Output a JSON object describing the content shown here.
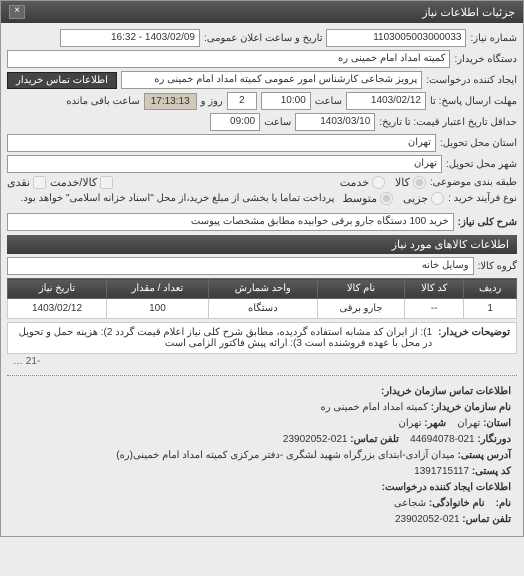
{
  "window": {
    "title": "جزئیات اطلاعات نیاز",
    "close": "×"
  },
  "fields": {
    "number_label": "شماره نیاز:",
    "number_value": "1103005003000033",
    "datetime_label": "تاریخ و ساعت اعلان عمومی:",
    "datetime_value": "1403/02/09 - 16:32",
    "buyer_label": "دستگاه خریدار:",
    "buyer_value": "کمیته امداد امام خمینی ره",
    "creator_label": "ایجاد کننده درخواست:",
    "creator_value": "پرویز شجاعی کارشناس امور عمومی کمیته امداد امام خمینی ره",
    "contact_btn": "اطلاعات تماس خریدار",
    "deadline_send_label": "مهلت ارسال پاسخ: تا",
    "deadline_send_date": "1403/02/12",
    "deadline_send_time_lbl": "ساعت",
    "deadline_send_time": "10:00",
    "days_label": "روز و",
    "days_value": "2",
    "remaining_label": "ساعت باقی مانده",
    "countdown": "17:13:13",
    "valid_label": "حداقل تاریخ اعتبار قیمت: تا تاریخ:",
    "valid_date": "1403/03/10",
    "valid_time_lbl": "ساعت",
    "valid_time": "09:00",
    "province_label": "استان محل تحویل:",
    "province_value": "تهران",
    "city_label": "شهر محل تحویل:",
    "city_value": "تهران",
    "category_label": "طبقه بندی موضوعی:",
    "cat_goods": "کالا",
    "cat_service": "خدمت",
    "payment_label": "کالا/خدمت",
    "pay_cash": "نقدی",
    "process_label": "نوع فرآیند خرید :",
    "proc_small": "جزیی",
    "proc_medium": "متوسط",
    "process_note": "پرداخت تماما یا بخشی از مبلغ خرید،از محل \"اسناد خزانه اسلامی\" خواهد بود.",
    "subject_label": "شرح کلی نیاز:",
    "subject_value": "خرید 100 دستگاه جارو برقی خوابیده مطابق مشخصات پیوست"
  },
  "goods_header": "اطلاعات کالاهای مورد نیاز",
  "group_label": "گروه کالا:",
  "group_value": "وسایل خانه",
  "table": {
    "headers": [
      "ردیف",
      "کد کالا",
      "نام کالا",
      "واحد شمارش",
      "تعداد / مقدار",
      "تاریخ نیاز"
    ],
    "row": [
      "1",
      "--",
      "جارو برقی",
      "دستگاه",
      "100",
      "1403/02/12"
    ]
  },
  "buyer_note_label": "توضیحات خریدار:",
  "buyer_note": "1): از ایران کد مشابه استفاده گردیده، مطابق شرح کلی نیاز اعلام قیمت گردد 2): هزینه حمل و تحویل در محل با عهده فروشنده است 3): ارائه پیش فاکتور الزامی است",
  "pager": "-21 …",
  "contact": {
    "org_title": "اطلاعات تماس سازمان خریدار:",
    "org_name_lbl": "نام سازمان خریدار:",
    "org_name": "کمیته امداد امام خمینی ره",
    "city_lbl": "شهر:",
    "city": "تهران",
    "province_lbl": "استان:",
    "province": "تهران",
    "fax_lbl": "دورنگار:",
    "fax": "021-44694078",
    "phone_lbl": "تلفن تماس:",
    "phone": "021-23902052",
    "addr_lbl": "آدرس پستی:",
    "addr": "میدان آزادی-ابتدای بزرگراه شهید لشگری -دفتر مرکزی کمیته امداد امام خمینی(ره)",
    "post_lbl": "کد پستی:",
    "post": "1391715117",
    "req_title": "اطلاعات ایجاد کننده درخواست:",
    "name_lbl": "نام:",
    "fname_lbl": "نام خانوادگی:",
    "fname": "شجاعی",
    "rphone_lbl": "تلفن تماس:",
    "rphone": "021-23902052"
  }
}
